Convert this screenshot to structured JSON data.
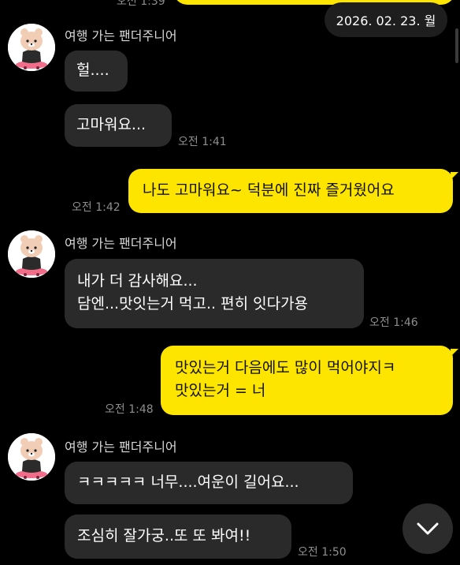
{
  "date_badge": "2026. 02. 23. 월",
  "top_partial_time": "오전 1:39",
  "sender_name": "여행 가는 팬더주니어",
  "messages": [
    {
      "text": "헐...."
    },
    {
      "text": "고마워요...",
      "time": "오전 1:41"
    },
    {
      "text": "나도 고마워요~ 덕분에 진짜 즐거웠어요",
      "time": "오전 1:42"
    },
    {
      "lines": [
        "내가 더 감사해요...",
        "담엔...맛잇는거 먹고.. 편히 잇다가용"
      ],
      "time": "오전 1:46"
    },
    {
      "lines": [
        "맛있는거 다음에도 많이 먹어야지ㅋ",
        "맛있는거 = 너"
      ],
      "time": "오전 1:48"
    },
    {
      "text": "ㅋㅋㅋㅋㅋ 너무....여운이 길어요..."
    },
    {
      "text": "조심히 잘가궁..또 또 봐여!!",
      "time": "오전 1:50"
    }
  ],
  "icons": {
    "avatar": "bear-avatar-icon",
    "scroll_down": "chevron-down-icon"
  },
  "colors": {
    "background": "#000000",
    "incoming_bubble": "#2a2a2a",
    "outgoing_bubble": "#fee500",
    "timestamp": "#8e8e8e"
  }
}
